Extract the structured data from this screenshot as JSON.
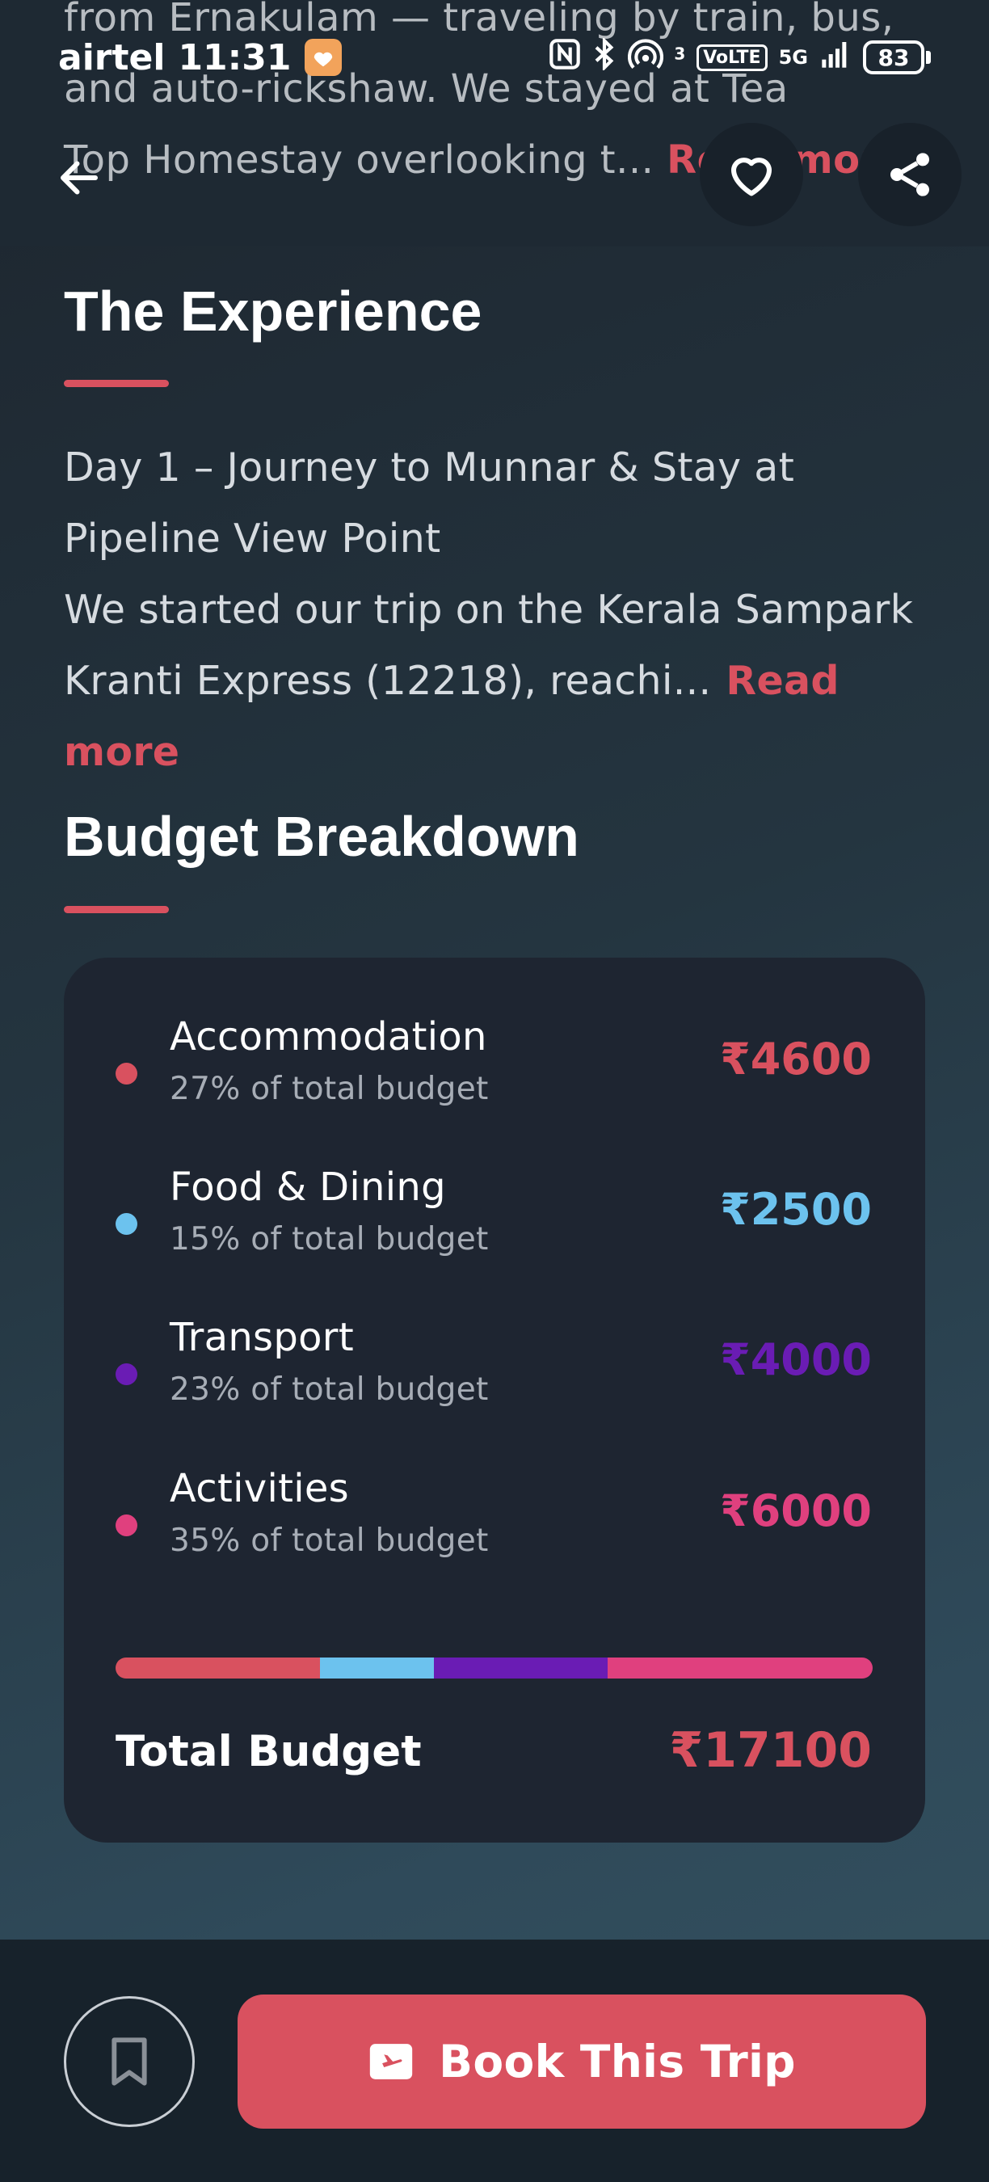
{
  "status_bar": {
    "carrier": "airtel",
    "time": "11:31",
    "indicators": [
      "nfc-icon",
      "bluetooth-icon",
      "hotspot-icon",
      "volte-icon",
      "5g-icon",
      "signal-icon"
    ],
    "hotspot_sup": "3",
    "volte": "VoLTE",
    "network": "5G",
    "battery": "83"
  },
  "header": {
    "faded_lines": [
      "from Ernakulam — traveling by train, bus,",
      "and auto-rickshaw. We stayed at Tea",
      "Top Homestay overlooking t..."
    ],
    "faded_read_more": "Read more"
  },
  "experience": {
    "title": "The Experience",
    "line1": "Day 1 – Journey to Munnar & Stay at",
    "line2": "Pipeline View Point",
    "line3": "We started our trip on the Kerala Sampark",
    "line4": "Kranti Express (12218), reachi...",
    "read_more": "Read more"
  },
  "budget": {
    "title": "Budget Breakdown",
    "items": [
      {
        "label": "Accommodation",
        "sub": "27% of total budget",
        "amount": "₹4600",
        "percent": 27,
        "color": "#d9515f"
      },
      {
        "label": "Food & Dining",
        "sub": "15% of total budget",
        "amount": "₹2500",
        "percent": 15,
        "color": "#6cc2ee"
      },
      {
        "label": "Transport",
        "sub": "23% of total budget",
        "amount": "₹4000",
        "percent": 23,
        "color": "#6a1cb4"
      },
      {
        "label": "Activities",
        "sub": "35% of total budget",
        "amount": "₹6000",
        "percent": 35,
        "color": "#e0407e"
      }
    ],
    "total_label": "Total Budget",
    "total_amount": "₹17100"
  },
  "footer": {
    "book_label": "Book This Trip"
  },
  "colors": {
    "accent": "#d9515f",
    "card": "#1e2531",
    "bottom_bar": "#17222b"
  }
}
